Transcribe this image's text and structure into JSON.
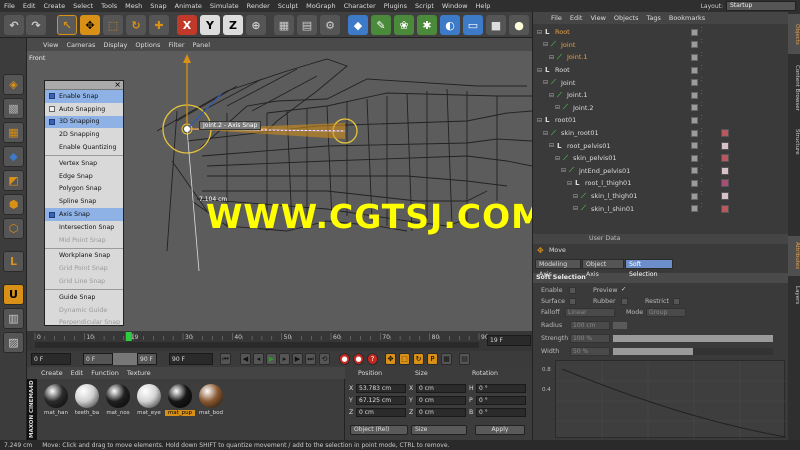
{
  "menubar": {
    "items": [
      "File",
      "Edit",
      "Create",
      "Select",
      "Tools",
      "Mesh",
      "Snap",
      "Animate",
      "Simulate",
      "Render",
      "Sculpt",
      "MoGraph",
      "Character",
      "Plugins",
      "Script",
      "Window",
      "Help"
    ],
    "layout_label": "Layout:",
    "layout_value": "Startup"
  },
  "viewport": {
    "menu": [
      "View",
      "Cameras",
      "Display",
      "Options",
      "Filter",
      "Panel"
    ],
    "view_name": "Front",
    "hud_label": "Joint.2 - Axis Snap",
    "distance_label": "7.104 cm"
  },
  "snap_menu": {
    "items": [
      {
        "label": "Enable Snap",
        "state": "active"
      },
      {
        "label": "Auto Snapping",
        "state": "normal"
      },
      {
        "label": "3D Snapping",
        "state": "active"
      },
      {
        "label": "2D Snapping",
        "state": "normal"
      },
      {
        "label": "Enable Quantizing",
        "state": "normal"
      },
      {
        "label": "Vertex Snap",
        "state": "normal"
      },
      {
        "label": "Edge Snap",
        "state": "normal"
      },
      {
        "label": "Polygon Snap",
        "state": "normal"
      },
      {
        "label": "Spline Snap",
        "state": "normal"
      },
      {
        "label": "Axis Snap",
        "state": "active"
      },
      {
        "label": "Intersection Snap",
        "state": "normal"
      },
      {
        "label": "Mid Point Snap",
        "state": "disabled"
      },
      {
        "label": "Workplane Snap",
        "state": "normal"
      },
      {
        "label": "Grid Point Snap",
        "state": "disabled"
      },
      {
        "label": "Grid Line Snap",
        "state": "disabled"
      },
      {
        "label": "Guide Snap",
        "state": "normal"
      },
      {
        "label": "Dynamic Guide",
        "state": "disabled"
      },
      {
        "label": "Perpendicular Snap",
        "state": "disabled"
      }
    ]
  },
  "timeline": {
    "ticks": [
      "0",
      "10",
      "19",
      "30",
      "40",
      "50",
      "60",
      "70",
      "80",
      "90"
    ],
    "current_frame": "19 F"
  },
  "transport": {
    "start": "0 F",
    "min": "0 F",
    "max": "90 F",
    "end": "90 F"
  },
  "materials": {
    "menu": [
      "Create",
      "Edit",
      "Function",
      "Texture"
    ],
    "brand": "MAXON CINEMA4D",
    "items": [
      {
        "name": "mat_han",
        "color": "#2b2b2b"
      },
      {
        "name": "teeth_ba",
        "color": "#cfcfcf"
      },
      {
        "name": "mat_nos",
        "color": "#202020"
      },
      {
        "name": "mat_eye",
        "color": "#d4d4d4"
      },
      {
        "name": "mat_pup",
        "color": "#161616"
      },
      {
        "name": "mat_bod",
        "color": "#8a5a32"
      }
    ]
  },
  "coordinates": {
    "headers": {
      "position": "Position",
      "size": "Size",
      "rotation": "Rotation"
    },
    "rows": [
      {
        "axis": "X",
        "pos": "53.783 cm",
        "size": "0 cm",
        "rot_axis": "H",
        "rot": "0 °"
      },
      {
        "axis": "Y",
        "pos": "67.125 cm",
        "size": "0 cm",
        "rot_axis": "P",
        "rot": "0 °"
      },
      {
        "axis": "Z",
        "pos": "0 cm",
        "size": "0 cm",
        "rot_axis": "B",
        "rot": "0 °"
      }
    ],
    "mode_select": "Object (Rel)",
    "size_select": "Size",
    "apply_label": "Apply"
  },
  "object_manager": {
    "menu": [
      "File",
      "Edit",
      "View",
      "Objects",
      "Tags",
      "Bookmarks"
    ],
    "items": [
      {
        "label": "Root",
        "depth": 0,
        "hl": true,
        "type": "null"
      },
      {
        "label": "Joint",
        "depth": 1,
        "hl": true,
        "type": "joint"
      },
      {
        "label": "Joint.1",
        "depth": 2,
        "hl": true,
        "type": "joint"
      },
      {
        "label": "Root",
        "depth": 0,
        "hl": false,
        "type": "null"
      },
      {
        "label": "Joint",
        "depth": 1,
        "hl": false,
        "type": "joint"
      },
      {
        "label": "Joint.1",
        "depth": 2,
        "hl": false,
        "type": "joint"
      },
      {
        "label": "Joint.2",
        "depth": 3,
        "hl": false,
        "type": "joint"
      },
      {
        "label": "root01",
        "depth": 0,
        "hl": false,
        "type": "null"
      },
      {
        "label": "skin_root01",
        "depth": 1,
        "hl": false,
        "type": "joint",
        "tex": "#b8585e"
      },
      {
        "label": "root_pelvis01",
        "depth": 2,
        "hl": false,
        "type": "null",
        "tex": "#d7c0c9"
      },
      {
        "label": "skin_pelvis01",
        "depth": 3,
        "hl": false,
        "type": "joint",
        "tex": "#b8585e"
      },
      {
        "label": "jntEnd_pelvis01",
        "depth": 4,
        "hl": false,
        "type": "joint",
        "tex": "#d7c0c9"
      },
      {
        "label": "root_l_thigh01",
        "depth": 5,
        "hl": false,
        "type": "null",
        "tex": "#a44e78"
      },
      {
        "label": "skin_l_thigh01",
        "depth": 6,
        "hl": false,
        "type": "joint",
        "tex": "#d7c0c9"
      },
      {
        "label": "skin_l_shin01",
        "depth": 6,
        "hl": false,
        "type": "joint",
        "tex": "#b8585e"
      }
    ]
  },
  "attributes": {
    "header_partial": "User Data",
    "object_title": "Move",
    "tabs": [
      {
        "label": "Modeling Axis",
        "on": false
      },
      {
        "label": "Object Axis",
        "on": false
      },
      {
        "label": "Soft Selection",
        "on": true
      }
    ],
    "section": "Soft Selection",
    "enable": "Enable",
    "preview": "Preview",
    "preview_mark": "✓",
    "surface": "Surface",
    "rubber": "Rubber",
    "restrict": "Restrict",
    "falloff_label": "Falloff",
    "falloff_value": "Linear",
    "mode_label": "Mode",
    "mode_value": "Group",
    "radius_label": "Radius",
    "radius_value": "100 cm",
    "strength_label": "Strength",
    "strength_value": "100 %",
    "strength_fraction": 1.0,
    "width_label": "Width",
    "width_value": "50 %",
    "width_fraction": 0.5,
    "graph_ticks": [
      "0.8",
      "0.4"
    ]
  },
  "side_tabs": {
    "right_top": [
      "Objects",
      "Content Browser",
      "Structure"
    ],
    "right_bottom": [
      "Attributes",
      "Layers"
    ]
  },
  "status": {
    "value": "7.249 cm",
    "message": "Move: Click and drag to move elements. Hold down SHIFT to quantize movement / add to the selection in point mode, CTRL to remove."
  },
  "watermark": "WWW.CGTSJ.COM"
}
